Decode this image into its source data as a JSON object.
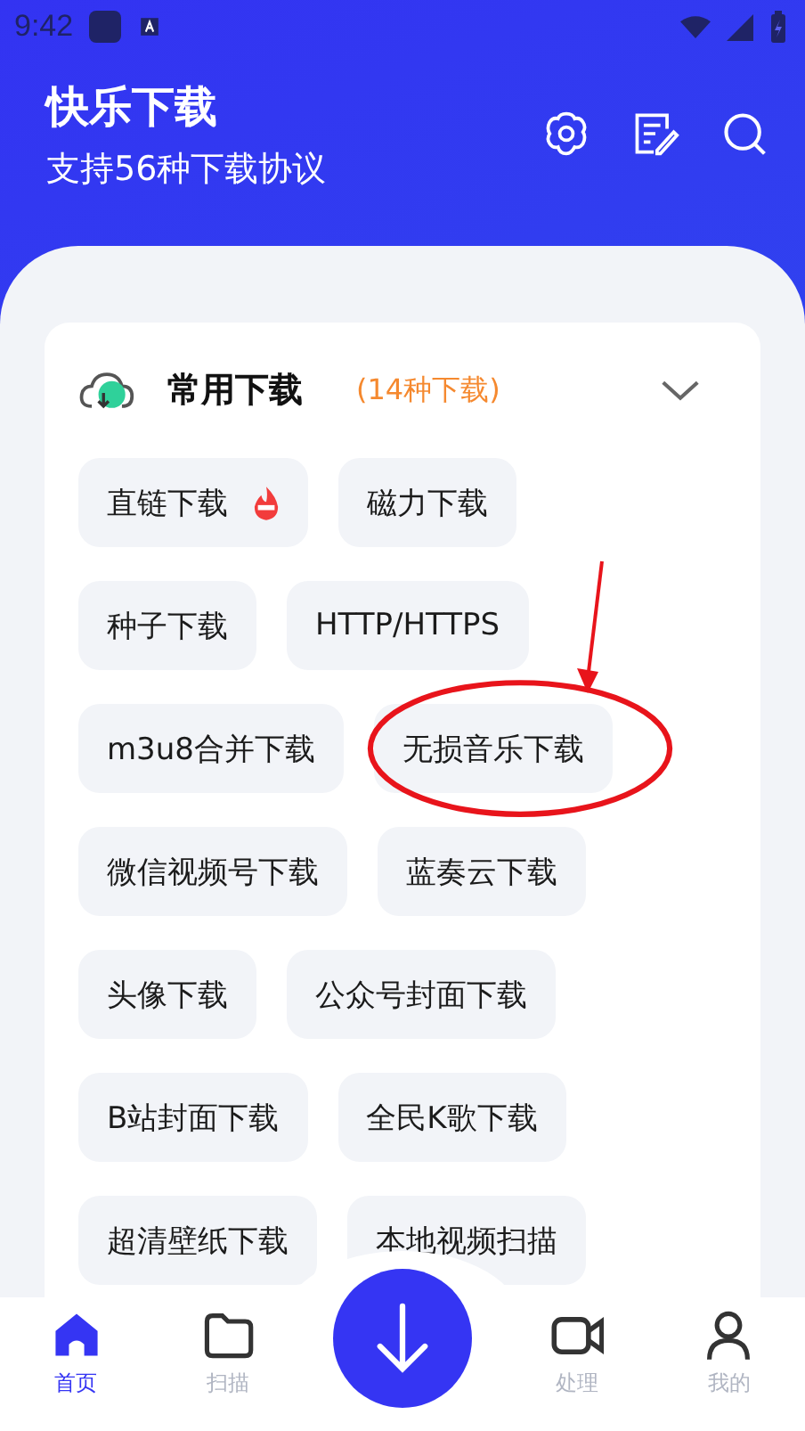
{
  "status_bar": {
    "time": "9:42"
  },
  "header": {
    "title": "快乐下载",
    "subtitle": "支持56种下载协议"
  },
  "section": {
    "title": "常用下载",
    "count": "(14种下载)",
    "expanded": true,
    "items": [
      {
        "label": "直链下载",
        "hot": true,
        "circled": false
      },
      {
        "label": "磁力下载",
        "hot": false,
        "circled": false
      },
      {
        "label": "种子下载",
        "hot": false,
        "circled": false
      },
      {
        "label": "HTTP/HTTPS",
        "hot": false,
        "circled": false
      },
      {
        "label": "m3u8合并下载",
        "hot": false,
        "circled": false
      },
      {
        "label": "无损音乐下载",
        "hot": false,
        "circled": true
      },
      {
        "label": "微信视频号下载",
        "hot": false,
        "circled": false
      },
      {
        "label": "蓝奏云下载",
        "hot": false,
        "circled": false
      },
      {
        "label": "头像下载",
        "hot": false,
        "circled": false
      },
      {
        "label": "公众号封面下载",
        "hot": false,
        "circled": false
      },
      {
        "label": "B站封面下载",
        "hot": false,
        "circled": false
      },
      {
        "label": "全民K歌下载",
        "hot": false,
        "circled": false
      },
      {
        "label": "超清壁纸下载",
        "hot": false,
        "circled": false
      },
      {
        "label": "本地视频扫描",
        "hot": false,
        "circled": false
      }
    ]
  },
  "tabs": [
    {
      "label": "首页",
      "kind": "home",
      "selected": true
    },
    {
      "label": "扫描",
      "kind": "folder",
      "selected": false
    },
    {
      "label": "处理",
      "kind": "video",
      "selected": false
    },
    {
      "label": "我的",
      "kind": "person",
      "selected": false
    }
  ]
}
